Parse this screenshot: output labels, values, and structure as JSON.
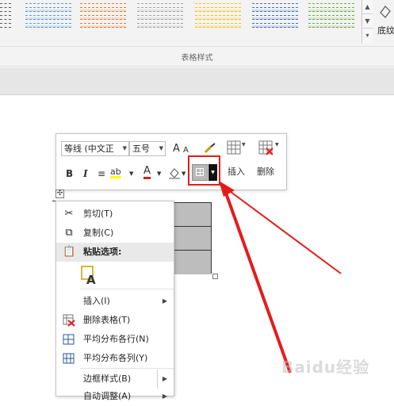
{
  "ribbon": {
    "group_label": "表格样式",
    "shading_label": "底纹",
    "table_styles": [
      {
        "color": "#5b5b5b"
      },
      {
        "color": "#5b9bd5"
      },
      {
        "color": "#ed7d31"
      },
      {
        "color": "#a5a5a5"
      },
      {
        "color": "#ffc000"
      },
      {
        "color": "#4472c4"
      },
      {
        "color": "#70ad47"
      }
    ],
    "gallery_scroll": {
      "up_icon": "scroll-up-icon",
      "down_icon": "scroll-down-icon",
      "more_icon": "more-icon"
    }
  },
  "mini_toolbar": {
    "font_name": "等线 (中文正",
    "font_size": "五号",
    "grow_font": "A",
    "shrink_font": "A",
    "bold": "B",
    "italic": "I",
    "align": "≡",
    "highlight": "ab",
    "font_color": "A",
    "insert_label": "插入",
    "delete_label": "删除",
    "colors": {
      "highlight": "#ffff00",
      "font_color": "#e51b1b",
      "callout": "#e51b1b"
    }
  },
  "context_menu": {
    "items": [
      {
        "label": "剪切(T)",
        "icon": "scissors-icon"
      },
      {
        "label": "复制(C)",
        "icon": "copy-icon"
      },
      {
        "label": "粘贴选项:",
        "icon": "paste-icon"
      },
      {
        "label": "",
        "icon": "paste-keep-text-icon"
      },
      {
        "label": "插入(I)",
        "icon": ""
      },
      {
        "label": "删除表格(T)",
        "icon": "delete-table-icon"
      },
      {
        "label": "平均分布各行(N)",
        "icon": "distribute-rows-icon"
      },
      {
        "label": "平均分布各列(Y)",
        "icon": "distribute-columns-icon"
      },
      {
        "label": "边框样式(B)",
        "icon": ""
      },
      {
        "label": "自动调整(A)",
        "icon": ""
      }
    ]
  },
  "watermark": "Baidu经验"
}
